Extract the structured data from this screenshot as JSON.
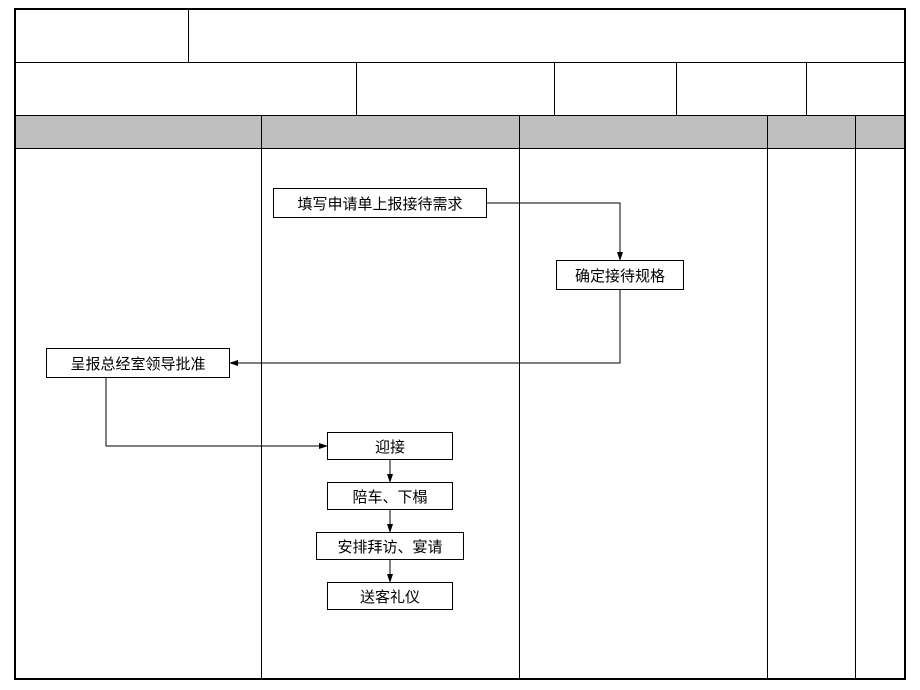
{
  "boxes": {
    "fill_request": "填写申请单上报接待需求",
    "confirm_spec": "确定接待规格",
    "report_approval": "呈报总经室领导批准",
    "welcome": "迎接",
    "escort": "陪车、下榻",
    "arrange_visit": "安排拜访、宴请",
    "farewell": "送客礼仪"
  }
}
